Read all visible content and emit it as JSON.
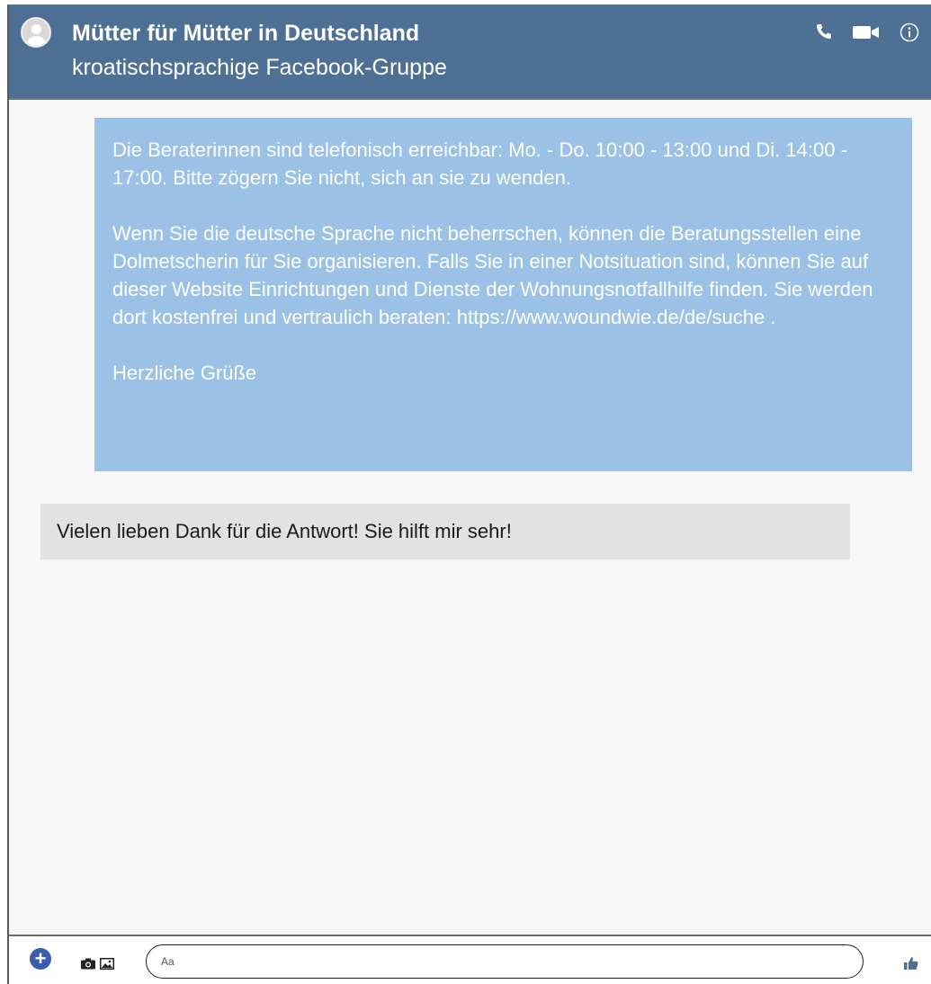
{
  "header": {
    "title": "Mütter für Mütter in Deutschland",
    "subtitle": "kroatischsprachige Facebook-Gruppe",
    "icons": [
      "avatar",
      "phone-icon",
      "video-icon",
      "info-icon"
    ]
  },
  "messages": [
    {
      "direction": "outgoing",
      "paragraphs": [
        "Die Beraterinnen sind telefonisch erreichbar: Mo. - Do. 10:00 - 13:00 und Di. 14:00 - 17:00. Bitte zögern Sie nicht, sich an sie zu wenden.",
        "Wenn Sie die deutsche Sprache nicht beherrschen, können die Beratungsstellen eine Dolmetscherin für Sie organisieren. Falls Sie in einer Notsituation sind, können Sie auf dieser Website Einrichtungen und Dienste der Wohnungsnotfallhilfe finden. Sie werden dort kostenfrei und vertraulich beraten: https://www.woundwie.de/de/suche .",
        "Herzliche Grüße"
      ]
    },
    {
      "direction": "incoming",
      "text": "Vielen lieben Dank für die Antwort! Sie hilft mir sehr!"
    }
  ],
  "composer": {
    "placeholder": "Aa",
    "icons": [
      "plus-icon",
      "camera-icon",
      "image-icon",
      "like-icon"
    ]
  },
  "colors": {
    "header_bg": "#4e7095",
    "outgoing_bubble": "#9bc1e6",
    "incoming_bubble": "#e2e2e2",
    "accent": "#3b5db0"
  }
}
